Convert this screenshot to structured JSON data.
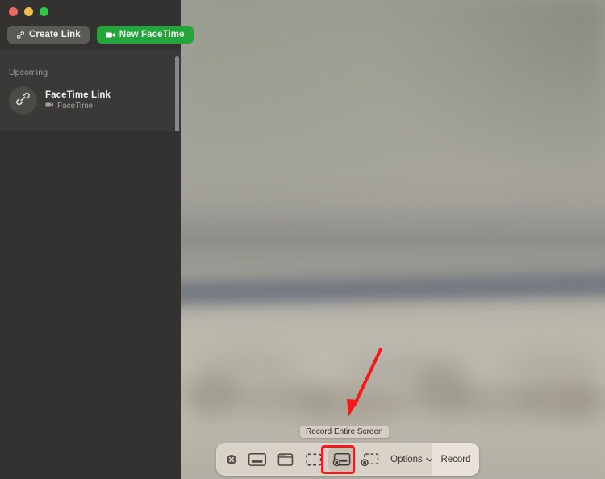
{
  "window": {
    "app_name": "FaceTime",
    "traffic_lights": [
      {
        "name": "close",
        "color": "#ec6a5f"
      },
      {
        "name": "minimize",
        "color": "#f2bd4c"
      },
      {
        "name": "zoom",
        "color": "#2fc840"
      }
    ]
  },
  "sidebar": {
    "create_link_label": "Create Link",
    "new_facetime_label": "New FaceTime",
    "create_link_icon": "link-icon",
    "new_facetime_icon": "video-camera-icon",
    "section_title": "Upcoming",
    "items": [
      {
        "title": "FaceTime Link",
        "subtitle": "FaceTime",
        "avatar_icon": "link-icon",
        "subtitle_icon": "video-camera-icon"
      }
    ]
  },
  "screenshot_toolbar": {
    "close_icon": "close-x-icon",
    "tooltip": "Record Entire Screen",
    "options_label": "Options",
    "options_chevron_icon": "chevron-down-icon",
    "record_label": "Record",
    "selected_tool": "record-entire-screen",
    "tools": [
      {
        "id": "capture-entire-screen",
        "name": "capture-entire-screen-icon",
        "selected": false
      },
      {
        "id": "capture-selected-window",
        "name": "capture-selected-window-icon",
        "selected": false
      },
      {
        "id": "capture-selected-portion",
        "name": "capture-selected-portion-icon",
        "selected": false
      },
      {
        "id": "record-entire-screen",
        "name": "record-entire-screen-icon",
        "selected": true
      },
      {
        "id": "record-selected-portion",
        "name": "record-selected-portion-icon",
        "selected": false
      }
    ],
    "highlight_color": "#f41a1a",
    "toolbar_bg": "#d8d2c8",
    "record_bg": "#e8e2da"
  },
  "annotation": {
    "arrow_color": "#f41a1a",
    "arrow_from": "472,433",
    "arrow_to": "434,514"
  }
}
